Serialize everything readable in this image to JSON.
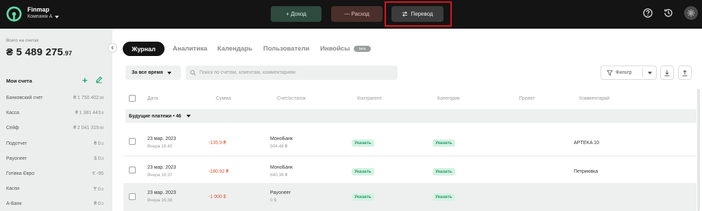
{
  "app": {
    "name": "Finmap",
    "company": "Компанія А"
  },
  "topbar": {
    "income_label": "+ Доход",
    "expense_label": "— Расход",
    "transfer_label": "Перевод"
  },
  "sidebar": {
    "balance_label": "Всего на счетах",
    "balance_main": "₴ 5 489 275",
    "balance_dec": ".97",
    "accounts_title": "Мои счета",
    "accounts": [
      {
        "name": "Банковский счет",
        "amount": "₴ 1 750 402",
        "dec": ".08"
      },
      {
        "name": "Касса",
        "amount": "₴ 1 381 443",
        "dec": ".8"
      },
      {
        "name": "Сейф",
        "amount": "₴ 2 041 319",
        "dec": ".99"
      },
      {
        "name": "Подотчет",
        "amount": "₴ 0",
        "dec": ".0"
      },
      {
        "name": "Payoneer",
        "amount": "$ 0",
        "dec": ".0"
      },
      {
        "name": "Готівка Євро",
        "amount": "€ -95",
        "dec": ""
      },
      {
        "name": "Каспи",
        "amount": "₸ 0",
        "dec": ".0"
      },
      {
        "name": "А-Банк",
        "amount": "₴ 0",
        "dec": ".0"
      }
    ]
  },
  "tabs": {
    "active": "Журнал",
    "items": [
      "Аналитика",
      "Календарь",
      "Пользователи",
      "Инвойсы"
    ],
    "beta": "beta"
  },
  "filters": {
    "period": "За все время",
    "search_placeholder": "Поиск по счетам, клиентам, комментариям",
    "filter_label": "Фильтр"
  },
  "table": {
    "headers": [
      "Дата",
      "Сумма",
      "Счет/остаток",
      "Контрагент",
      "Категория",
      "Проект",
      "Комментарий"
    ],
    "group_label": "Будущие платежи • 46",
    "rows": [
      {
        "date": "23 мар. 2023",
        "time": "Вчера 18:40",
        "sum": "-135.9 ₴",
        "account": "МоноБанк",
        "balance": "504.48 ₴",
        "counterparty": "Указать",
        "category": "Указать",
        "comment": "APTEKA 10"
      },
      {
        "date": "23 мар. 2023",
        "time": "Вчера 18:37",
        "sum": "-180.92 ₴",
        "account": "МоноБанк",
        "balance": "640.38 ₴",
        "counterparty": "Указать",
        "category": "Указать",
        "comment": "Петриківка"
      },
      {
        "date": "23 мар. 2023",
        "time": "Вчера 16:38",
        "sum": "-1 000  $",
        "account": "Payoneer",
        "balance": "0  $",
        "counterparty": "Указать",
        "category": "Указать",
        "comment": ""
      }
    ]
  },
  "colors": {
    "accent_green": "#16a36a",
    "negative": "#e8542e",
    "highlight": "#e0161b"
  }
}
